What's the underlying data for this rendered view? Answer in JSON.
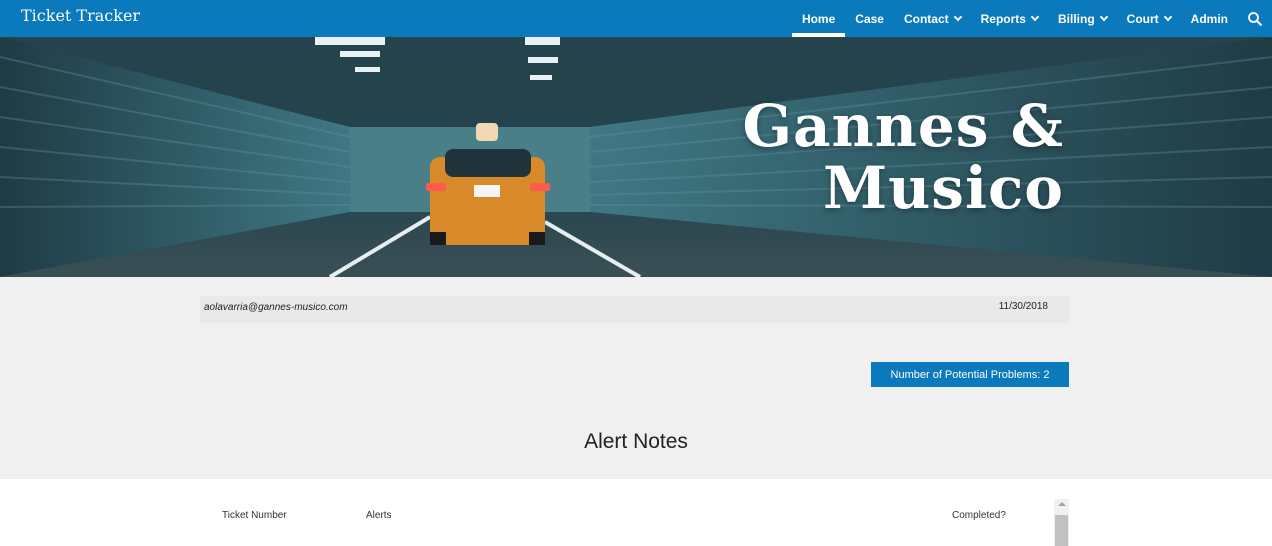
{
  "header": {
    "site_title": "Ticket Tracker",
    "nav": [
      {
        "label": "Home",
        "active": true,
        "dropdown": false
      },
      {
        "label": "Case",
        "active": false,
        "dropdown": false
      },
      {
        "label": "Contact",
        "active": false,
        "dropdown": true
      },
      {
        "label": "Reports",
        "active": false,
        "dropdown": true
      },
      {
        "label": "Billing",
        "active": false,
        "dropdown": true
      },
      {
        "label": "Court",
        "active": false,
        "dropdown": true
      },
      {
        "label": "Admin",
        "active": false,
        "dropdown": false
      }
    ],
    "search_icon": "search-icon"
  },
  "hero": {
    "title_line1": "Gannes &",
    "title_line2": "Musico"
  },
  "info": {
    "email": "aolavarria@gannes-musico.com",
    "date": "11/30/2018"
  },
  "problems_button": "Number of Potential Problems: 2",
  "alert_notes": {
    "title": "Alert Notes",
    "columns": [
      "Ticket Number",
      "Alerts",
      "Completed?"
    ]
  },
  "colors": {
    "accent": "#0a7abd",
    "background": "#f0f0f0"
  }
}
